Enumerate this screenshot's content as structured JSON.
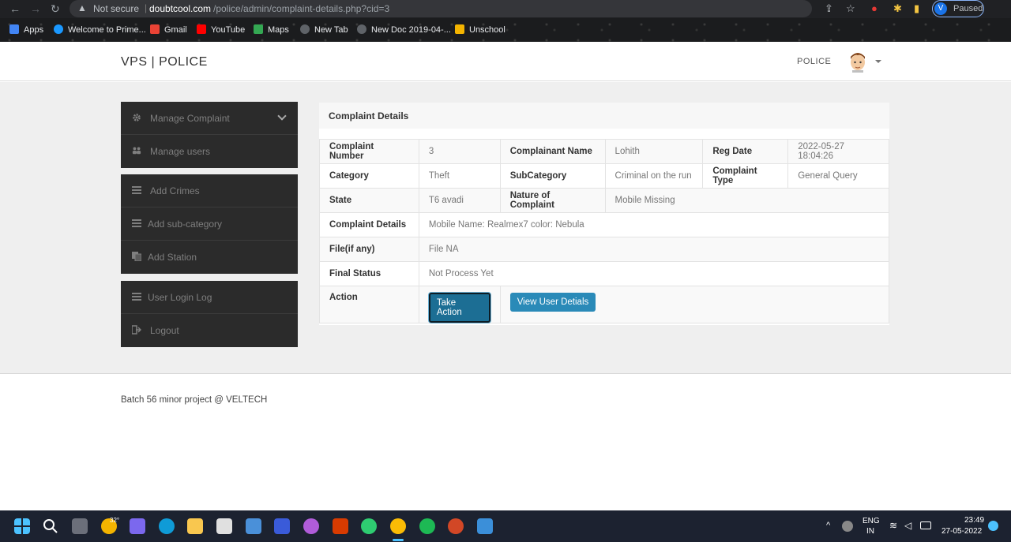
{
  "browser": {
    "not_secure": "Not secure",
    "url_host": "doubtcool.com",
    "url_path": "/police/admin/complaint-details.php?cid=3",
    "profile_initial": "V",
    "profile_status": "Paused",
    "bookmarks": [
      {
        "label": "Apps",
        "color": "#4285f4"
      },
      {
        "label": "Welcome to Prime...",
        "color": "#1a98ff"
      },
      {
        "label": "Gmail",
        "color": "#ea4335"
      },
      {
        "label": "YouTube",
        "color": "#ff0000"
      },
      {
        "label": "Maps",
        "color": "#34a853"
      },
      {
        "label": "New Tab",
        "color": "#9aa0a6"
      },
      {
        "label": "New Doc 2019-04-...",
        "color": "#9aa0a6"
      },
      {
        "label": "Unschool",
        "color": "#f4b400"
      }
    ]
  },
  "header": {
    "brand": "VPS | POLICE",
    "role": "POLICE"
  },
  "sidebar": {
    "group1": [
      {
        "label": "Manage Complaint",
        "icon": "gear-icon"
      },
      {
        "label": "Manage users",
        "icon": "users-icon"
      }
    ],
    "group2": [
      {
        "label": "Add Crimes",
        "icon": "list-icon"
      },
      {
        "label": "Add sub-category",
        "icon": "list-icon"
      },
      {
        "label": "Add Station",
        "icon": "copy-icon"
      }
    ],
    "group3": [
      {
        "label": "User Login Log",
        "icon": "list-icon"
      },
      {
        "label": "Logout",
        "icon": "signout-icon"
      }
    ]
  },
  "panel": {
    "title": "Complaint Details",
    "row1": {
      "l1": "Complaint Number",
      "v1": "3",
      "l2": "Complainant Name",
      "v2": "Lohith",
      "l3": "Reg Date",
      "v3": "2022-05-27 18:04:26"
    },
    "row2": {
      "l1": "Category",
      "v1": "Theft",
      "l2": "SubCategory",
      "v2": "Criminal on the run",
      "l3": "Complaint Type",
      "v3": "General Query"
    },
    "row3": {
      "l1": "State",
      "v1": "T6 avadi",
      "l2": "Nature of Complaint",
      "v2": "Mobile Missing"
    },
    "row4": {
      "label": "Complaint Details",
      "value": "Mobile Name: Realmex7 color: Nebula"
    },
    "row5": {
      "label": "File(if any)",
      "value": "File NA"
    },
    "row6": {
      "label": "Final Status",
      "value": "Not Process Yet"
    },
    "row7": {
      "label": "Action",
      "take_action": "Take Action",
      "view_user": "View User Detials"
    }
  },
  "footer": {
    "text": "Batch 56 minor project @ VELTECH"
  },
  "taskbar": {
    "weather": "32°",
    "lang1": "ENG",
    "lang2": "IN",
    "time": "23:49",
    "date": "27-05-2022"
  }
}
